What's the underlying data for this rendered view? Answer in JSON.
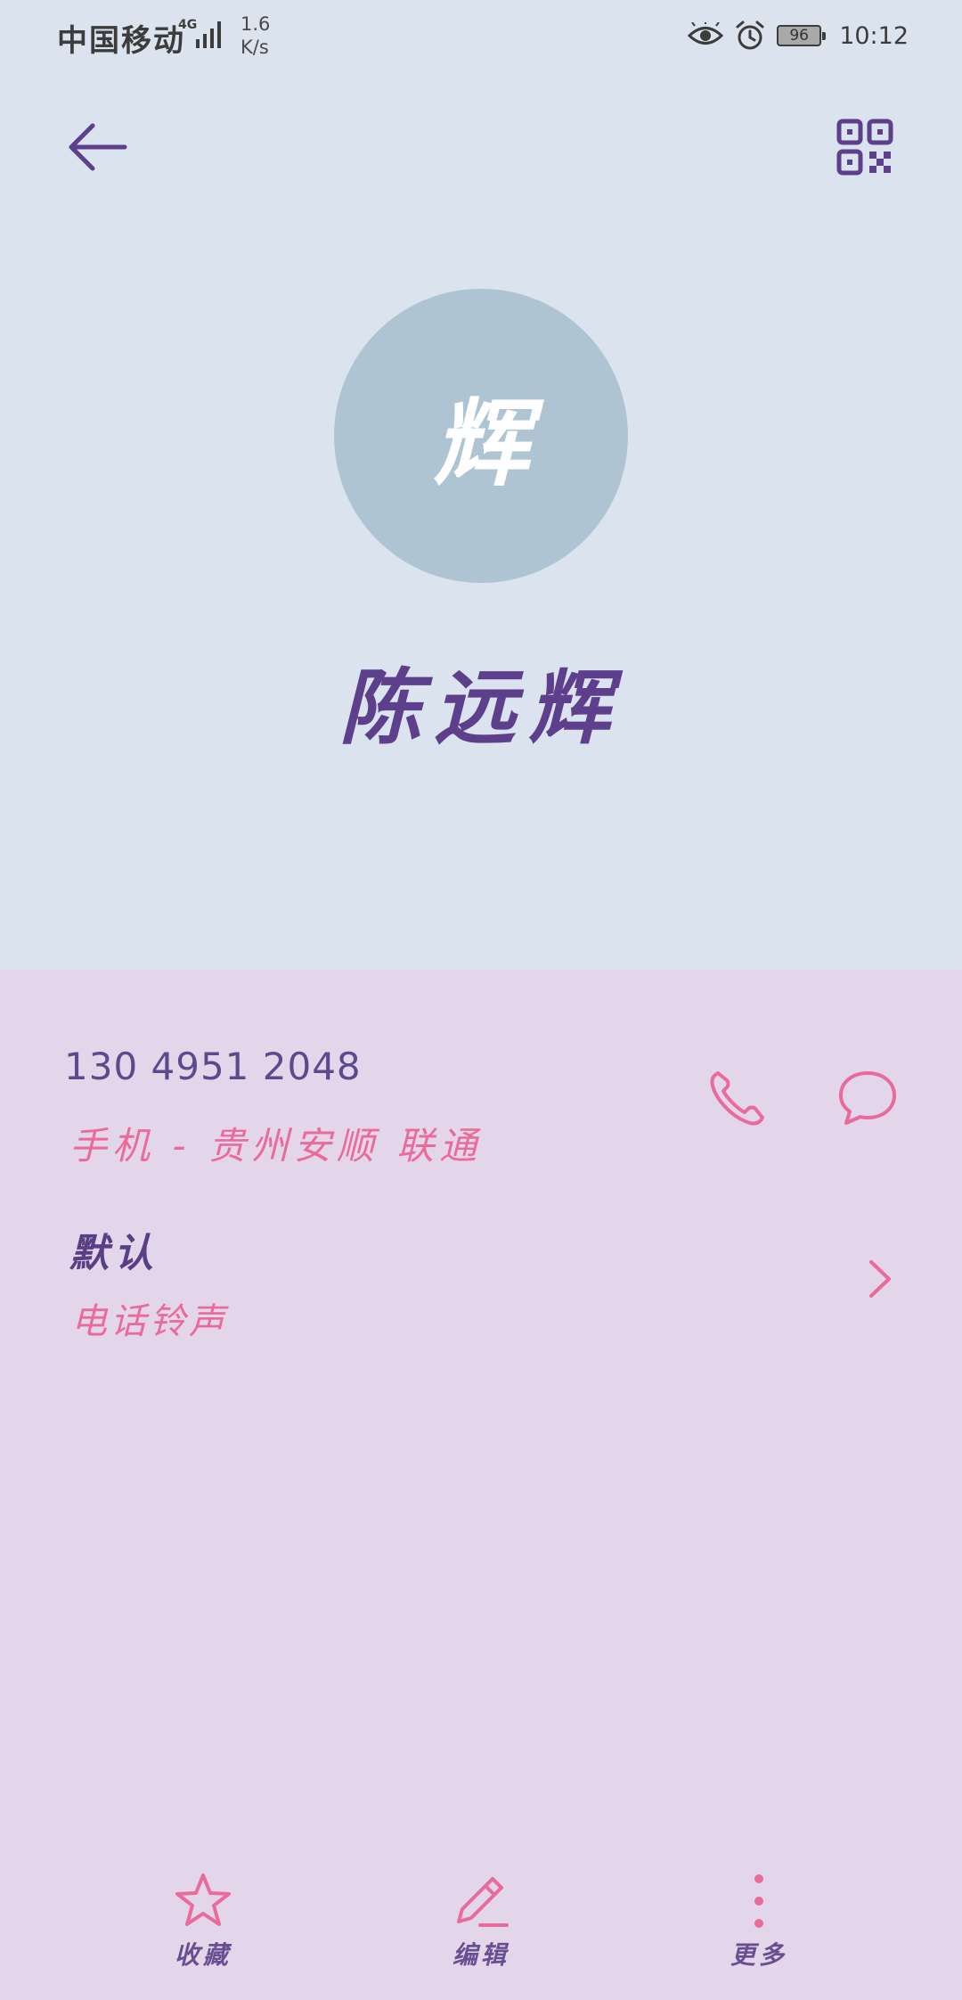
{
  "status_bar": {
    "carrier": "中国移动",
    "network_type": "4G",
    "speed_value": "1.6",
    "speed_unit": "K/s",
    "battery": "96",
    "time": "10:12"
  },
  "header": {
    "avatar_letter": "辉",
    "contact_name": "陈远辉"
  },
  "phone": {
    "number": "130 4951 2048",
    "subtitle": "手机 - 贵州安顺 联通"
  },
  "ringtone": {
    "value": "默认",
    "label": "电话铃声"
  },
  "bottom_bar": {
    "favorite_label": "收藏",
    "edit_label": "编辑",
    "more_label": "更多"
  },
  "colors": {
    "header_bg": "#dbe3ee",
    "content_bg": "#e4d6ea",
    "accent_pink": "#ea6a9a",
    "accent_purple": "#5e3f8b",
    "avatar_bg": "#aec4d2"
  }
}
